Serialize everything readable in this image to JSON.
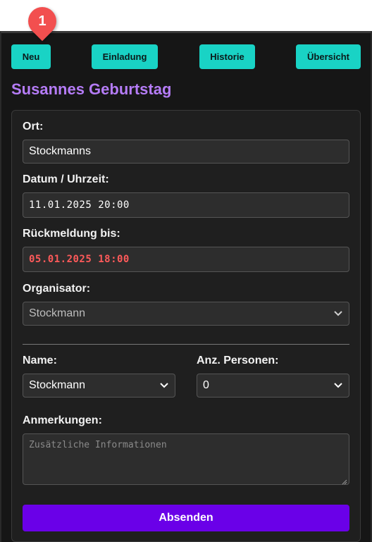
{
  "marker": {
    "number": "1"
  },
  "nav": {
    "new": "Neu",
    "invitation": "Einladung",
    "history": "Historie",
    "overview": "Übersicht"
  },
  "title": "Susannes Geburtstag",
  "form": {
    "location_label": "Ort:",
    "location_value": "Stockmanns",
    "datetime_label": "Datum / Uhrzeit:",
    "datetime_value": "11.01.2025 20:00",
    "reply_label": "Rückmeldung bis:",
    "reply_value": "05.01.2025 18:00",
    "organizer_label": "Organisator:",
    "organizer_value": "Stockmann",
    "name_label": "Name:",
    "name_value": "Stockmann",
    "persons_label": "Anz. Personen:",
    "persons_value": "0",
    "notes_label": "Anmerkungen:",
    "notes_placeholder": "Zusätzliche Informationen",
    "submit_label": "Absenden"
  },
  "colors": {
    "accent_teal": "#19d3c5",
    "title_purple": "#b57cf7",
    "submit_purple": "#6a00e8",
    "deadline_red": "#ff5a5a",
    "marker_red": "#f24f4f"
  },
  "icons": [
    "chevron-down-icon",
    "resize-grip-icon"
  ]
}
